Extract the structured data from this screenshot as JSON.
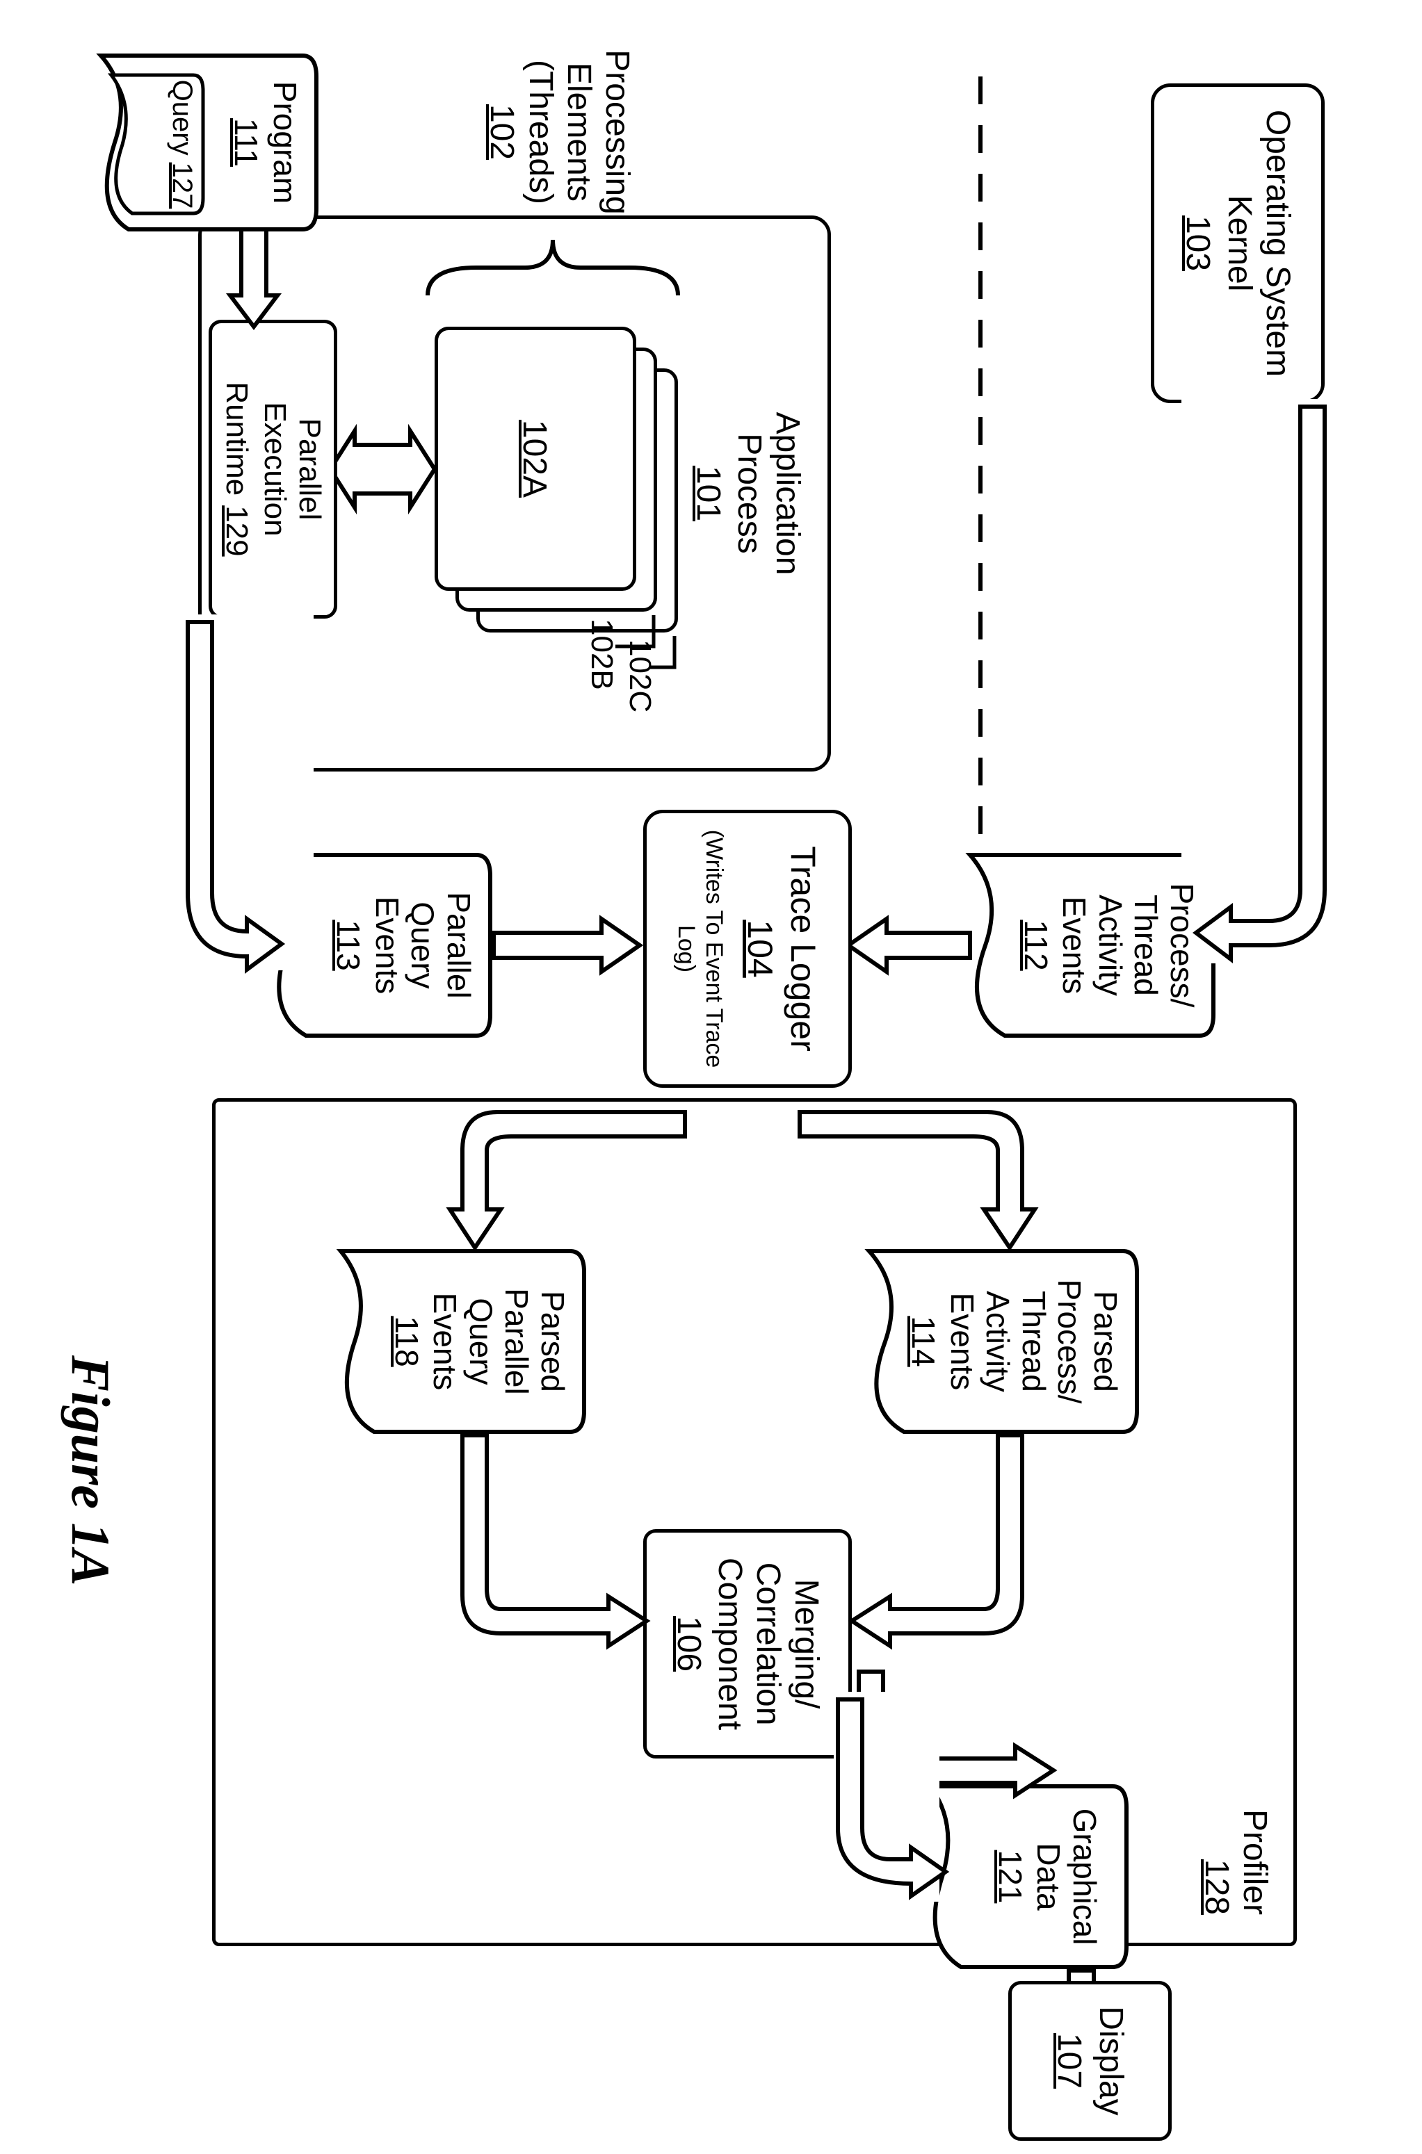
{
  "figure_caption": "Figure 1A",
  "os_kernel": {
    "label1": "Operating System",
    "label2": "Kernel",
    "ref": "103"
  },
  "app_process": {
    "label1": "Application",
    "label2": "Process",
    "ref": "101"
  },
  "processing_elements": {
    "label1": "Processing",
    "label2": "Elements",
    "label3": "(Threads)",
    "ref": "102"
  },
  "thread_a": {
    "label": "102A"
  },
  "thread_b": {
    "label": "102B"
  },
  "thread_c": {
    "label": "102C"
  },
  "parallel_runtime": {
    "label1": "Parallel",
    "label2": "Execution",
    "label3": "Runtime",
    "ref": "129"
  },
  "program": {
    "label": "Program",
    "ref": "111"
  },
  "query": {
    "label": "Query",
    "ref": "127"
  },
  "proc_thread_events": {
    "l1": "Process/",
    "l2": "Thread",
    "l3": "Activity",
    "l4": "Events",
    "ref": "112"
  },
  "parallel_query_events": {
    "l1": "Parallel",
    "l2": "Query",
    "l3": "Events",
    "ref": "113"
  },
  "trace_logger": {
    "label": "Trace Logger",
    "ref": "104",
    "note": "(Writes To Event Trace Log)"
  },
  "parsed_process_events": {
    "l1": "Parsed",
    "l2": "Process/",
    "l3": "Thread",
    "l4": "Activity",
    "l5": "Events",
    "ref": "114"
  },
  "parsed_parallel_events": {
    "l1": "Parsed",
    "l2": "Parallel",
    "l3": "Query",
    "l4": "Events",
    "ref": "118"
  },
  "merging": {
    "l1": "Merging/",
    "l2": "Correlation",
    "l3": "Component",
    "ref": "106"
  },
  "graphical_data": {
    "l1": "Graphical",
    "l2": "Data",
    "ref": "121"
  },
  "display": {
    "label": "Display",
    "ref": "107"
  },
  "profiler": {
    "label": "Profiler",
    "ref": "128"
  }
}
